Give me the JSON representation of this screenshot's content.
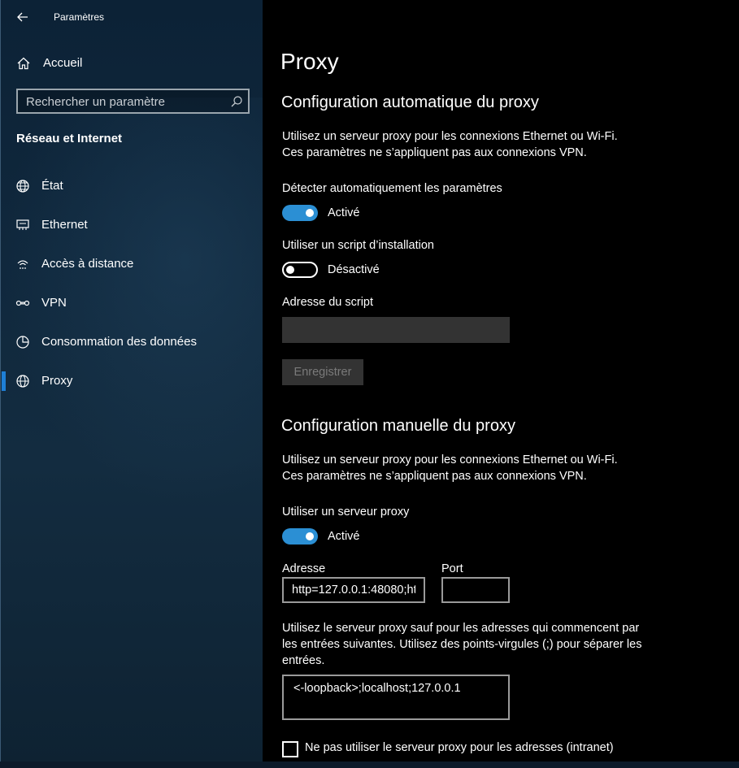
{
  "window": {
    "title": "Paramètres"
  },
  "sidebar": {
    "home_label": "Accueil",
    "search_placeholder": "Rechercher un paramètre",
    "section_title": "Réseau et Internet",
    "items": [
      {
        "label": "État",
        "icon": "globe-status-icon"
      },
      {
        "label": "Ethernet",
        "icon": "ethernet-icon"
      },
      {
        "label": "Accès à distance",
        "icon": "dial-up-icon"
      },
      {
        "label": "VPN",
        "icon": "vpn-icon"
      },
      {
        "label": "Consommation des données",
        "icon": "data-usage-icon"
      },
      {
        "label": "Proxy",
        "icon": "globe-icon",
        "selected": true
      }
    ]
  },
  "main": {
    "page_title": "Proxy",
    "auto": {
      "heading": "Configuration automatique du proxy",
      "desc_line1": "Utilisez un serveur proxy pour les connexions Ethernet ou Wi-Fi.",
      "desc_line2": "Ces paramètres ne s’appliquent pas aux connexions VPN.",
      "detect_label": "Détecter automatiquement les paramètres",
      "detect_state": "Activé",
      "script_label": "Utiliser un script d’installation",
      "script_state": "Désactivé",
      "script_address_label": "Adresse du script",
      "script_address_value": "",
      "save_label": "Enregistrer"
    },
    "manual": {
      "heading": "Configuration manuelle du proxy",
      "desc_line1": "Utilisez un serveur proxy pour les connexions Ethernet ou Wi-Fi.",
      "desc_line2": "Ces paramètres ne s’appliquent pas aux connexions VPN.",
      "use_proxy_label": "Utiliser un serveur proxy",
      "use_proxy_state": "Activé",
      "address_label": "Adresse",
      "address_value": "http=127.0.0.1:48080;ht",
      "port_label": "Port",
      "port_value": "",
      "exceptions_line1": "Utilisez le serveur proxy sauf pour les adresses qui commencent par",
      "exceptions_line2": "les entrées suivantes. Utilisez des points-virgules (;) pour séparer les",
      "exceptions_line3": "entrées.",
      "exceptions_value": "<-loopback>;localhost;127.0.0.1",
      "bypass_local_label": "Ne pas utiliser le serveur proxy pour les adresses (intranet)"
    }
  },
  "colors": {
    "accent": "#2b8fd4",
    "sidebar_bg": "#10283d",
    "main_bg": "#000000"
  }
}
